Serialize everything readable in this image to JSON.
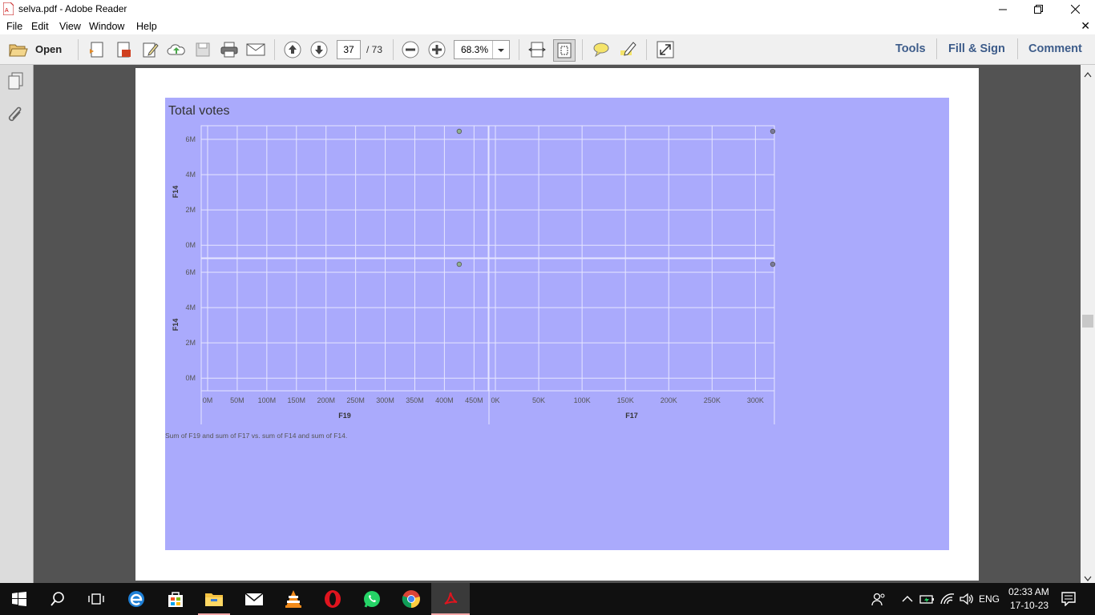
{
  "window": {
    "title": "selva.pdf - Adobe Reader"
  },
  "menu": {
    "items": [
      "File",
      "Edit",
      "View",
      "Window",
      "Help"
    ],
    "close_glyph": "✕"
  },
  "toolbar": {
    "open_label": "Open",
    "page_current": "37",
    "page_total": "/ 73",
    "zoom": "68.3%",
    "tools_label": "Tools",
    "fill_sign_label": "Fill & Sign",
    "comment_label": "Comment"
  },
  "chart_data": {
    "type": "scatter",
    "title": "Total votes",
    "caption": "Sum of F19 and sum of F17 vs. sum of F14 and sum of F14.",
    "panels": [
      {
        "row": 1,
        "col": 1,
        "xlabel": "F19",
        "ylabel": "F14",
        "xlim": [
          0,
          450000000
        ],
        "ylim": [
          0,
          6500000
        ],
        "points": [
          {
            "x": 425000000,
            "y": 6500000
          }
        ]
      },
      {
        "row": 1,
        "col": 2,
        "xlabel": "F17",
        "ylabel": "F14",
        "xlim": [
          0,
          320000
        ],
        "ylim": [
          0,
          6500000
        ],
        "points": [
          {
            "x": 320000,
            "y": 6500000
          }
        ]
      },
      {
        "row": 2,
        "col": 1,
        "xlabel": "F19",
        "ylabel": "F14",
        "xlim": [
          0,
          450000000
        ],
        "ylim": [
          0,
          6500000
        ],
        "points": [
          {
            "x": 425000000,
            "y": 6500000
          }
        ]
      },
      {
        "row": 2,
        "col": 2,
        "xlabel": "F17",
        "ylabel": "F14",
        "xlim": [
          0,
          320000
        ],
        "ylim": [
          0,
          6500000
        ],
        "points": [
          {
            "x": 320000,
            "y": 6500000
          }
        ]
      }
    ],
    "y_ticks": [
      {
        "v": 0,
        "label": "0M"
      },
      {
        "v": 2000000,
        "label": "2M"
      },
      {
        "v": 4000000,
        "label": "4M"
      },
      {
        "v": 6000000,
        "label": "6M"
      }
    ],
    "x1_ticks": [
      {
        "v": 0,
        "label": "0M"
      },
      {
        "v": 50000000,
        "label": "50M"
      },
      {
        "v": 100000000,
        "label": "100M"
      },
      {
        "v": 150000000,
        "label": "150M"
      },
      {
        "v": 200000000,
        "label": "200M"
      },
      {
        "v": 250000000,
        "label": "250M"
      },
      {
        "v": 300000000,
        "label": "300M"
      },
      {
        "v": 350000000,
        "label": "350M"
      },
      {
        "v": 400000000,
        "label": "400M"
      },
      {
        "v": 450000000,
        "label": "450M"
      }
    ],
    "x2_ticks": [
      {
        "v": 0,
        "label": "0K"
      },
      {
        "v": 50000,
        "label": "50K"
      },
      {
        "v": 100000,
        "label": "100K"
      },
      {
        "v": 150000,
        "label": "150K"
      },
      {
        "v": 200000,
        "label": "200K"
      },
      {
        "v": 250000,
        "label": "250K"
      },
      {
        "v": 300000,
        "label": "300K"
      }
    ],
    "x1label": "F19",
    "x2label": "F17",
    "ylabel": "F14",
    "grid": true,
    "colors": {
      "background": "#aaaafc",
      "point_fill_col1": "#8fb08f",
      "point_fill_col2": "#7a7a9a",
      "point_stroke": "#555555",
      "grid": "#e6e6ff"
    }
  },
  "taskbar": {
    "apps": [
      "start-icon",
      "search-icon",
      "task-view-icon",
      "edge-icon",
      "store-icon",
      "file-explorer-icon",
      "mail-icon",
      "vlc-icon",
      "opera-icon",
      "whatsapp-icon",
      "chrome-icon",
      "adobe-reader-icon"
    ],
    "lang": "ENG",
    "time": "02:33 AM",
    "date": "17-10-23"
  }
}
